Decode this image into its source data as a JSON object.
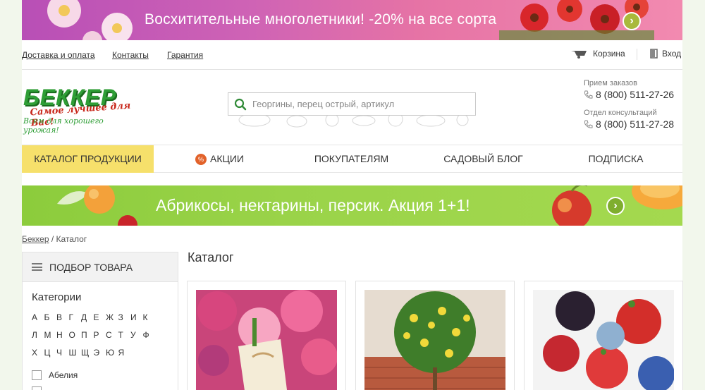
{
  "promo_top": {
    "text": "Восхитительные многолетники! -20% на все сорта",
    "arrow": "›"
  },
  "toplinks": {
    "delivery": "Доставка и оплата",
    "contacts": "Контакты",
    "warranty": "Гарантия",
    "cart": "Корзина",
    "login": "Вход"
  },
  "logo": {
    "brand": "БЕККЕР",
    "slogan": "Самое лучшее для Вас!",
    "tagline": "Всем для хорошего урожая!"
  },
  "search": {
    "placeholder": "Георгины, перец острый, артикул"
  },
  "phones": {
    "orders_label": "Прием заказов",
    "orders_number": "8 (800) 511-27-26",
    "consult_label": "Отдел консультаций",
    "consult_number": "8 (800) 511-27-28"
  },
  "nav": {
    "catalog": "КАТАЛОГ ПРОДУКЦИИ",
    "badge": "%",
    "promo": "АКЦИИ",
    "buyers": "ПОКУПАТЕЛЯМ",
    "blog": "САДОВЫЙ БЛОГ",
    "subscribe": "ПОДПИСКА"
  },
  "promo_mid": {
    "text": "Абрикосы, нектарины, персик. Акция 1+1!",
    "arrow": "›"
  },
  "breadcrumb": {
    "home": "Беккер",
    "sep": " / ",
    "current": "Каталог"
  },
  "sidebar": {
    "title": "ПОДБОР ТОВАРА",
    "categories_title": "Категории",
    "letters_row1": [
      "А",
      "Б",
      "В",
      "Г",
      "Д",
      "Е",
      "Ж",
      "З",
      "И",
      "К"
    ],
    "letters_row2": [
      "Л",
      "М",
      "Н",
      "О",
      "П",
      "Р",
      "С",
      "Т",
      "У",
      "Ф"
    ],
    "letters_row3": [
      "Х",
      "Ц",
      "Ч",
      "Ш",
      "Щ",
      "Э",
      "Ю",
      "Я"
    ],
    "items": [
      "Абелия"
    ]
  },
  "catalog": {
    "title": "Каталог"
  },
  "colors": {
    "accent_yellow": "#f6e06b",
    "brand_green": "#2f9e36",
    "brand_red": "#c8281c"
  }
}
